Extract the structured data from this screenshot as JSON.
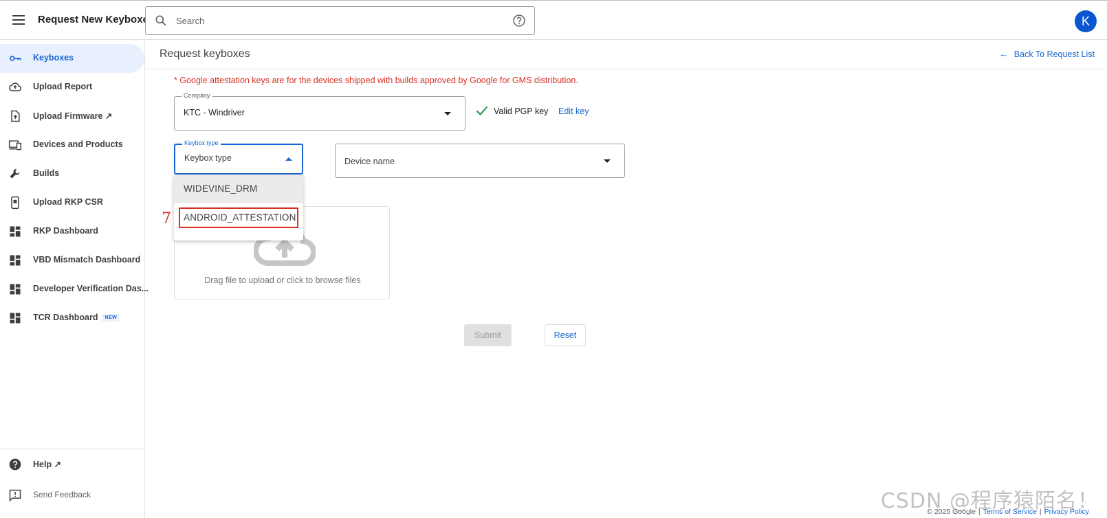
{
  "header": {
    "app_title": "Request New Keyboxes",
    "search_placeholder": "Search",
    "avatar_letter": "K",
    "avatar_color": "#0b57d0"
  },
  "sidebar": {
    "items": [
      {
        "label": "Keyboxes",
        "icon": "key-icon",
        "active": true
      },
      {
        "label": "Upload Report",
        "icon": "cloud-upload-icon"
      },
      {
        "label": "Upload Firmware ↗",
        "icon": "file-upload-icon"
      },
      {
        "label": "Devices and Products",
        "icon": "devices-icon"
      },
      {
        "label": "Builds",
        "icon": "wrench-icon"
      },
      {
        "label": "Upload RKP CSR",
        "icon": "phone-icon"
      },
      {
        "label": "RKP Dashboard",
        "icon": "dashboard-icon"
      },
      {
        "label": "VBD Mismatch Dashboard",
        "icon": "dashboard-icon"
      },
      {
        "label": "Developer Verification Das...",
        "icon": "dashboard-icon"
      },
      {
        "label": "TCR Dashboard",
        "icon": "dashboard-icon",
        "badge": "NEW"
      }
    ],
    "help_label": "Help ↗",
    "feedback_label": "Send Feedback"
  },
  "main": {
    "title": "Request keyboxes",
    "back_link": "Back To Request List",
    "notice": "* Google attestation keys are for the devices shipped with builds approved by Google for GMS distribution.",
    "company": {
      "legend": "Company",
      "value": "KTC - Windriver"
    },
    "pgp": {
      "status": "Valid PGP key",
      "edit": "Edit key"
    },
    "keybox_type": {
      "legend": "Keybox type",
      "value": "Keybox type"
    },
    "device_name": {
      "placeholder": "Device name"
    },
    "keybox_options": [
      "WIDEVINE_DRM",
      "ANDROID_ATTESTATION"
    ],
    "annotation_step": "7",
    "upload_text": "Drag file to upload or click to browse files",
    "submit_label": "Submit",
    "reset_label": "Reset"
  },
  "footer": {
    "copyright": "© 2025 Google",
    "terms": "Terms of Service",
    "privacy": "Privacy Policy",
    "separator": "|"
  },
  "watermark": "CSDN @程序猿陌名！",
  "colors": {
    "accent": "#1967d2",
    "error": "#d93025",
    "success": "#1e8e3e",
    "active_nav_bg": "#e8f0fe"
  }
}
